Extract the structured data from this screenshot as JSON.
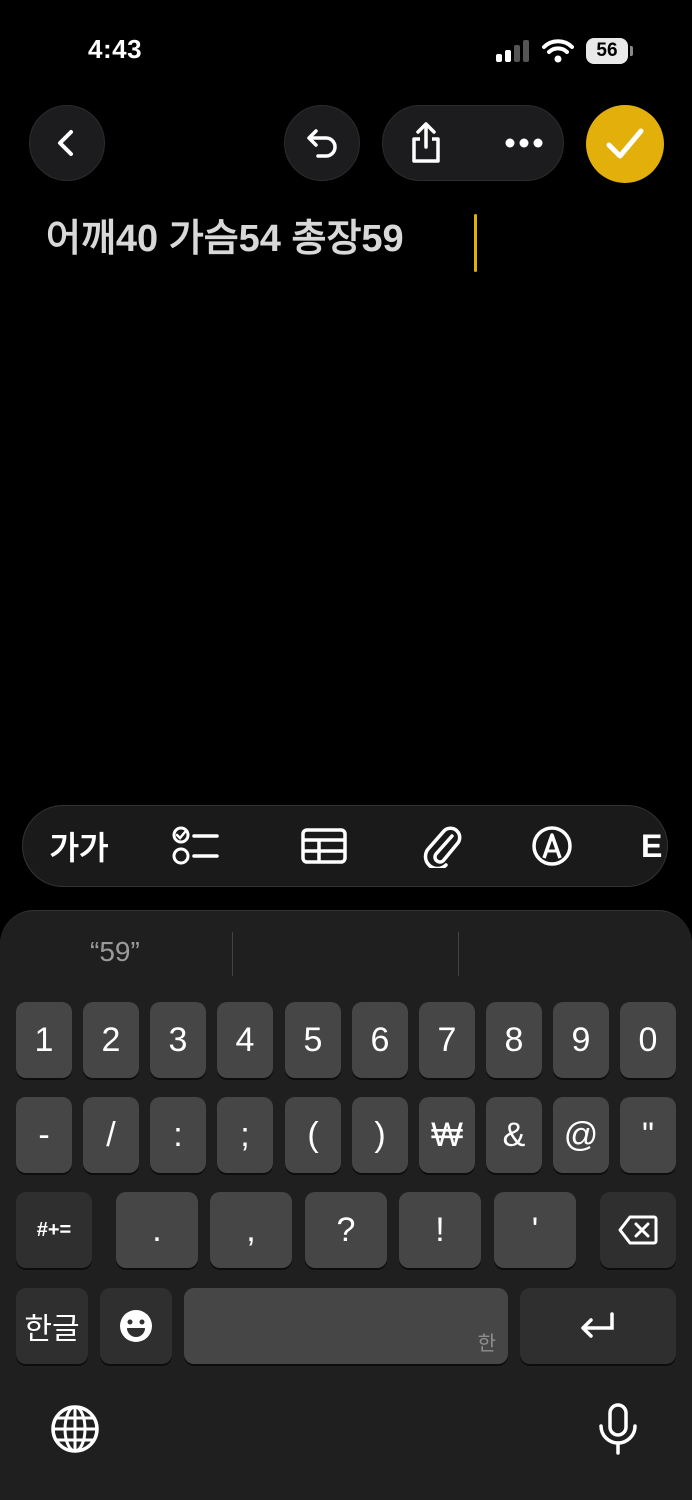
{
  "status_bar": {
    "time": "4:43",
    "battery": "56"
  },
  "note": {
    "text": "어깨40 가슴54 총장59"
  },
  "format_toolbar": {
    "text_style_label": "가가",
    "more_partial": "E"
  },
  "suggestion": {
    "text": "“59”"
  },
  "keyboard": {
    "row1": [
      "1",
      "2",
      "3",
      "4",
      "5",
      "6",
      "7",
      "8",
      "9",
      "0"
    ],
    "row2": [
      "-",
      "/",
      ":",
      ";",
      "(",
      ")",
      "₩",
      "&",
      "@",
      "\""
    ],
    "row3_left": "#+=",
    "row3": [
      ".",
      ",",
      "?",
      "!",
      "'"
    ],
    "lang_key": "한글",
    "space_hint": "한"
  },
  "colors": {
    "accent": "#e3b00b",
    "background": "#000000",
    "key": "#464646"
  }
}
